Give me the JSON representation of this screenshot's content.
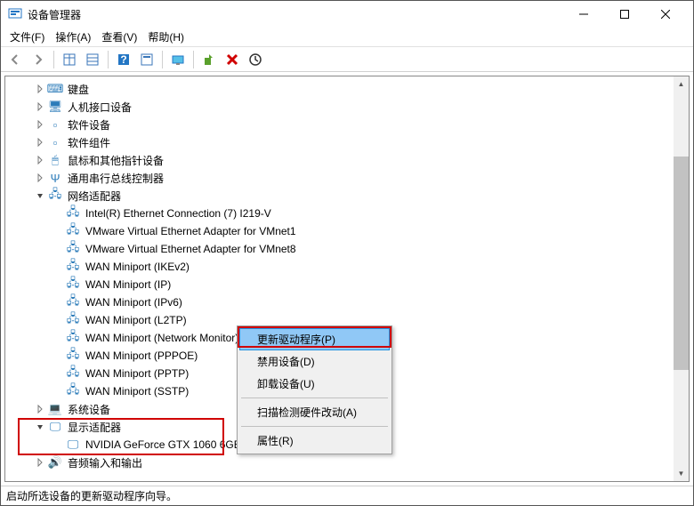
{
  "window": {
    "title": "设备管理器"
  },
  "menubar": {
    "file": "文件(F)",
    "action": "操作(A)",
    "view": "查看(V)",
    "help": "帮助(H)"
  },
  "tree": {
    "items": [
      {
        "indent": 1,
        "exp": "closed",
        "icon": "keyboard",
        "label": "键盘"
      },
      {
        "indent": 1,
        "exp": "closed",
        "icon": "hid",
        "label": "人机接口设备"
      },
      {
        "indent": 1,
        "exp": "closed",
        "icon": "software",
        "label": "软件设备"
      },
      {
        "indent": 1,
        "exp": "closed",
        "icon": "component",
        "label": "软件组件"
      },
      {
        "indent": 1,
        "exp": "closed",
        "icon": "mouse",
        "label": "鼠标和其他指针设备"
      },
      {
        "indent": 1,
        "exp": "closed",
        "icon": "usb",
        "label": "通用串行总线控制器"
      },
      {
        "indent": 1,
        "exp": "open",
        "icon": "network",
        "label": "网络适配器"
      },
      {
        "indent": 2,
        "exp": "none",
        "icon": "net",
        "label": "Intel(R) Ethernet Connection (7) I219-V"
      },
      {
        "indent": 2,
        "exp": "none",
        "icon": "net",
        "label": "VMware Virtual Ethernet Adapter for VMnet1"
      },
      {
        "indent": 2,
        "exp": "none",
        "icon": "net",
        "label": "VMware Virtual Ethernet Adapter for VMnet8"
      },
      {
        "indent": 2,
        "exp": "none",
        "icon": "net",
        "label": "WAN Miniport (IKEv2)"
      },
      {
        "indent": 2,
        "exp": "none",
        "icon": "net",
        "label": "WAN Miniport (IP)"
      },
      {
        "indent": 2,
        "exp": "none",
        "icon": "net",
        "label": "WAN Miniport (IPv6)"
      },
      {
        "indent": 2,
        "exp": "none",
        "icon": "net",
        "label": "WAN Miniport (L2TP)"
      },
      {
        "indent": 2,
        "exp": "none",
        "icon": "net",
        "label": "WAN Miniport (Network Monitor)"
      },
      {
        "indent": 2,
        "exp": "none",
        "icon": "net",
        "label": "WAN Miniport (PPPOE)"
      },
      {
        "indent": 2,
        "exp": "none",
        "icon": "net",
        "label": "WAN Miniport (PPTP)"
      },
      {
        "indent": 2,
        "exp": "none",
        "icon": "net",
        "label": "WAN Miniport (SSTP)"
      },
      {
        "indent": 1,
        "exp": "closed",
        "icon": "system",
        "label": "系统设备"
      },
      {
        "indent": 1,
        "exp": "open",
        "icon": "display",
        "label": "显示适配器"
      },
      {
        "indent": 2,
        "exp": "none",
        "icon": "display",
        "label": "NVIDIA GeForce GTX 1060 6GB",
        "selected": true
      },
      {
        "indent": 1,
        "exp": "closed",
        "icon": "audio",
        "label": "音频输入和输出"
      }
    ]
  },
  "context_menu": {
    "update_driver": "更新驱动程序(P)",
    "disable_device": "禁用设备(D)",
    "uninstall_device": "卸载设备(U)",
    "scan_hardware": "扫描检测硬件改动(A)",
    "properties": "属性(R)"
  },
  "statusbar": {
    "text": "启动所选设备的更新驱动程序向导。"
  },
  "icons": {
    "keyboard": "⌨",
    "hid": "🖥",
    "software": "▫",
    "component": "▫",
    "mouse": "🖱",
    "usb": "Ψ",
    "network": "🖧",
    "net": "🖧",
    "system": "💻",
    "display": "🖵",
    "audio": "🔊"
  }
}
